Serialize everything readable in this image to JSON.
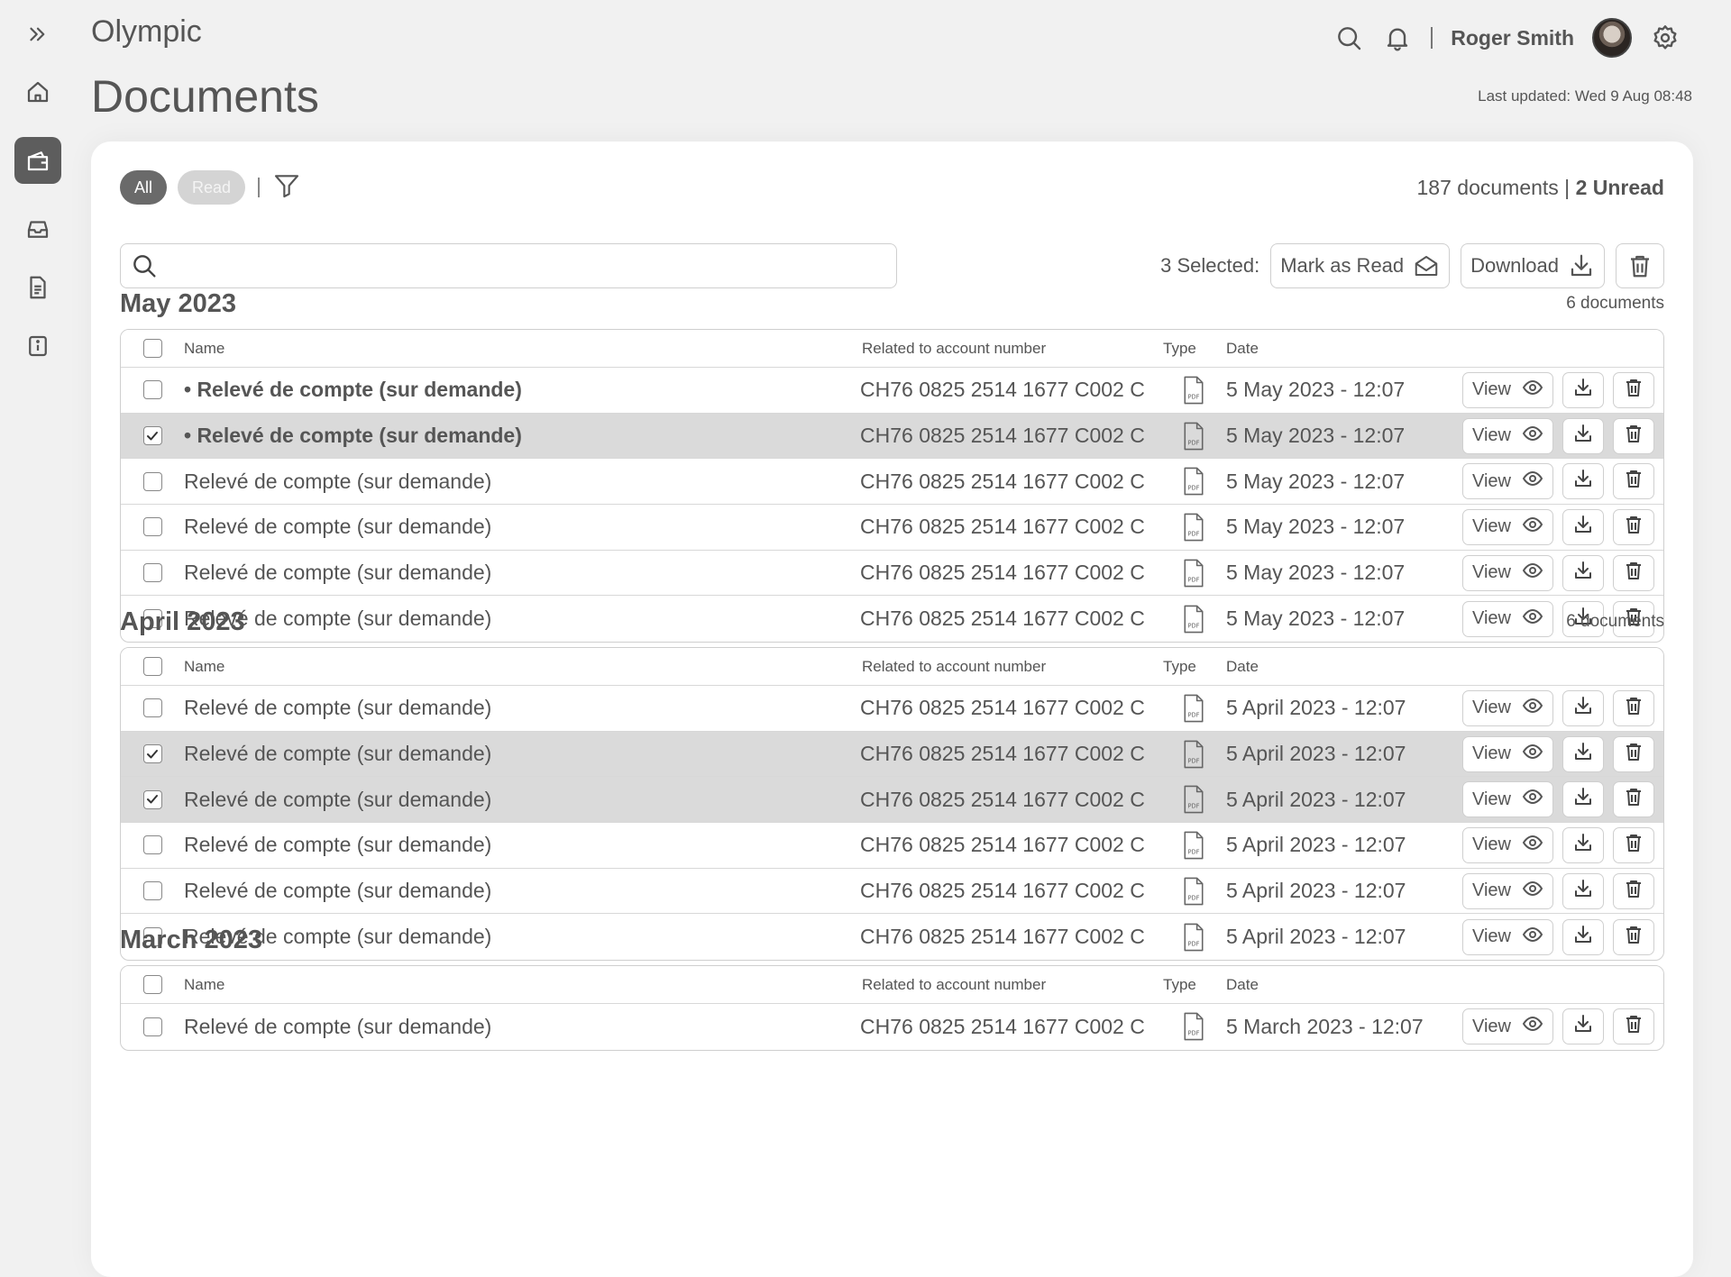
{
  "app": {
    "name": "Olympic",
    "page_title": "Documents",
    "last_updated": "Last updated: Wed 9 Aug 08:48"
  },
  "user": {
    "name": "Roger Smith"
  },
  "sidebar": {
    "items": [
      {
        "icon": "chevrons-right-icon"
      },
      {
        "icon": "home-icon"
      },
      {
        "icon": "wallet-icon",
        "active": true
      },
      {
        "icon": "inbox-icon"
      },
      {
        "icon": "document-icon"
      },
      {
        "icon": "info-icon"
      }
    ]
  },
  "filters": {
    "all": "All",
    "read": "Read"
  },
  "summary": {
    "total": "187 documents",
    "unread": "2 Unread"
  },
  "search": {
    "placeholder": ""
  },
  "bulk": {
    "selected": "3 Selected:",
    "mark_read": "Mark as Read",
    "download": "Download"
  },
  "columns": {
    "name": "Name",
    "account": "Related to account number",
    "type": "Type",
    "date": "Date"
  },
  "actions": {
    "view": "View"
  },
  "sections": [
    {
      "title": "May 2023",
      "count": "6 documents",
      "rows": [
        {
          "name": "• Relevé de compte (sur demande)",
          "account": "CH76 0825 2514 1677 C002 C",
          "date": "5 May 2023 - 12:07",
          "unread": true,
          "selected": false
        },
        {
          "name": "• Relevé de compte (sur demande)",
          "account": "CH76 0825 2514 1677 C002 C",
          "date": "5 May 2023 - 12:07",
          "unread": true,
          "selected": true
        },
        {
          "name": "Relevé de compte (sur demande)",
          "account": "CH76 0825 2514 1677 C002 C",
          "date": "5 May 2023 - 12:07",
          "unread": false,
          "selected": false
        },
        {
          "name": "Relevé de compte (sur demande)",
          "account": "CH76 0825 2514 1677 C002 C",
          "date": "5 May 2023 - 12:07",
          "unread": false,
          "selected": false
        },
        {
          "name": "Relevé de compte (sur demande)",
          "account": "CH76 0825 2514 1677 C002 C",
          "date": "5 May 2023 - 12:07",
          "unread": false,
          "selected": false
        },
        {
          "name": "Relevé de compte (sur demande)",
          "account": "CH76 0825 2514 1677 C002 C",
          "date": "5 May 2023 - 12:07",
          "unread": false,
          "selected": false
        }
      ]
    },
    {
      "title": "April 2023",
      "count": "6 documents",
      "rows": [
        {
          "name": "Relevé de compte (sur demande)",
          "account": "CH76 0825 2514 1677 C002 C",
          "date": "5 April 2023 - 12:07",
          "unread": false,
          "selected": false
        },
        {
          "name": "Relevé de compte (sur demande)",
          "account": "CH76 0825 2514 1677 C002 C",
          "date": "5 April 2023 - 12:07",
          "unread": false,
          "selected": true
        },
        {
          "name": "Relevé de compte (sur demande)",
          "account": "CH76 0825 2514 1677 C002 C",
          "date": "5 April 2023 - 12:07",
          "unread": false,
          "selected": true
        },
        {
          "name": "Relevé de compte (sur demande)",
          "account": "CH76 0825 2514 1677 C002 C",
          "date": "5 April 2023 - 12:07",
          "unread": false,
          "selected": false
        },
        {
          "name": "Relevé de compte (sur demande)",
          "account": "CH76 0825 2514 1677 C002 C",
          "date": "5 April 2023 - 12:07",
          "unread": false,
          "selected": false
        },
        {
          "name": "Relevé de compte (sur demande)",
          "account": "CH76 0825 2514 1677 C002 C",
          "date": "5 April 2023 - 12:07",
          "unread": false,
          "selected": false
        }
      ]
    },
    {
      "title": "March 2023",
      "count": "",
      "rows": [
        {
          "name": "Relevé de compte (sur demande)",
          "account": "CH76 0825 2514 1677 C002 C",
          "date": "5 March 2023 - 12:07",
          "unread": false,
          "selected": false
        }
      ]
    }
  ]
}
